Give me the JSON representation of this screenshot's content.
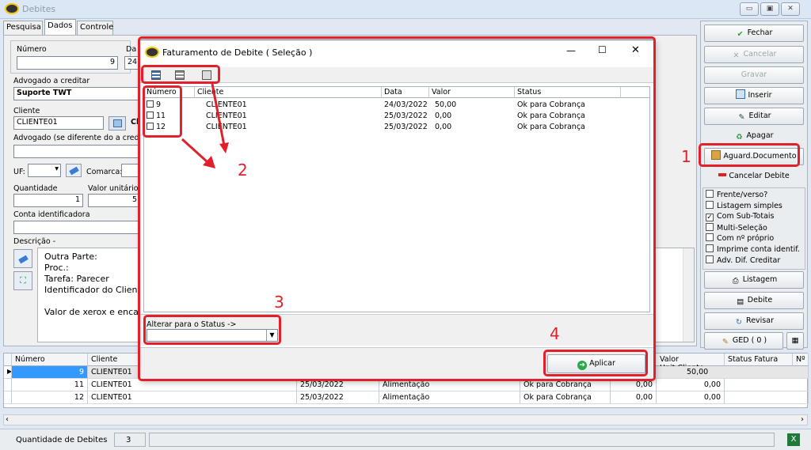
{
  "window": {
    "title": "Debites"
  },
  "tabs": [
    "Pesquisa",
    "Dados",
    "Controle"
  ],
  "form": {
    "numero_label": "Número",
    "numero_value": "9",
    "data_label_partial": "Da",
    "data_value_partial": "24",
    "advogado_label": "Advogado a creditar",
    "advogado_value": "Suporte TWT",
    "cliente_label": "Cliente",
    "cliente_value": "CLIENTE01",
    "cliente_extra": "Cl",
    "advogado2_label": "Advogado  (se diferente do a credita",
    "uf_label": "UF:",
    "comarca_label": "Comarca:",
    "quantidade_label": "Quantidade",
    "quantidade_value": "1",
    "valor_unit_label": "Valor unitário",
    "valor_unit_value": "5",
    "conta_label": "Conta identificadora",
    "descricao_label": "Descrição  -",
    "descricao_lines": [
      "Outra Parte:",
      "Proc.:",
      "Tarefa: Parecer",
      "Identificador do Cliente",
      "",
      "Valor de xerox e encad"
    ]
  },
  "sidebar": {
    "buttons": [
      "Fechar",
      "Cancelar",
      "Gravar",
      "Inserir",
      "Editar",
      "Apagar",
      "Aguard.Documento",
      "Cancelar Debite"
    ],
    "checks": [
      {
        "label": "Frente/verso?",
        "checked": false
      },
      {
        "label": "Listagem simples",
        "checked": false
      },
      {
        "label": "Com Sub-Totais",
        "checked": true
      },
      {
        "label": "Multi-Seleção",
        "checked": false
      },
      {
        "label": "Com nº próprio",
        "checked": false
      },
      {
        "label": "Imprime conta identif.",
        "checked": false
      },
      {
        "label": "Adv. Dif. Creditar",
        "checked": false
      }
    ],
    "bottom_buttons": [
      "Listagem",
      "Debite",
      "Revisar",
      "GED ( 0 )"
    ]
  },
  "grid": {
    "headers": [
      "Número",
      "Cliente",
      "Valor Unit.Cliente",
      "Status Fatura",
      "Nº"
    ],
    "rows": [
      {
        "numero": "9",
        "cliente": "CLIENTE01",
        "data": "",
        "tipo": "",
        "status": "",
        "v1": "",
        "v2": "50,00"
      },
      {
        "numero": "11",
        "cliente": "CLIENTE01",
        "data": "25/03/2022",
        "tipo": "Alimentação",
        "status": "Ok para Cobrança",
        "v1": "0,00",
        "v2": "0,00"
      },
      {
        "numero": "12",
        "cliente": "CLIENTE01",
        "data": "25/03/2022",
        "tipo": "Alimentação",
        "status": "Ok para Cobrança",
        "v1": "0,00",
        "v2": "0,00"
      }
    ]
  },
  "statusbar": {
    "label": "Quantidade de Debites",
    "value": "3"
  },
  "dialog": {
    "title": "Faturamento de Debite ( Seleção )",
    "columns": [
      "Número",
      "Cliente",
      "Data",
      "Valor",
      "Status"
    ],
    "rows": [
      {
        "numero": "9",
        "cliente": "CLIENTE01",
        "data": "24/03/2022",
        "valor": "50,00",
        "status": "Ok para Cobrança"
      },
      {
        "numero": "11",
        "cliente": "CLIENTE01",
        "data": "25/03/2022",
        "valor": "0,00",
        "status": "Ok para Cobrança"
      },
      {
        "numero": "12",
        "cliente": "CLIENTE01",
        "data": "25/03/2022",
        "valor": "0,00",
        "status": "Ok para Cobrança"
      }
    ],
    "status_label": "Alterar para o Status ->",
    "apply_label": "Aplicar"
  },
  "annotations": [
    "1",
    "2",
    "3",
    "4"
  ],
  "colors": {
    "highlight": "#e0202a",
    "selection": "#3399ff"
  }
}
